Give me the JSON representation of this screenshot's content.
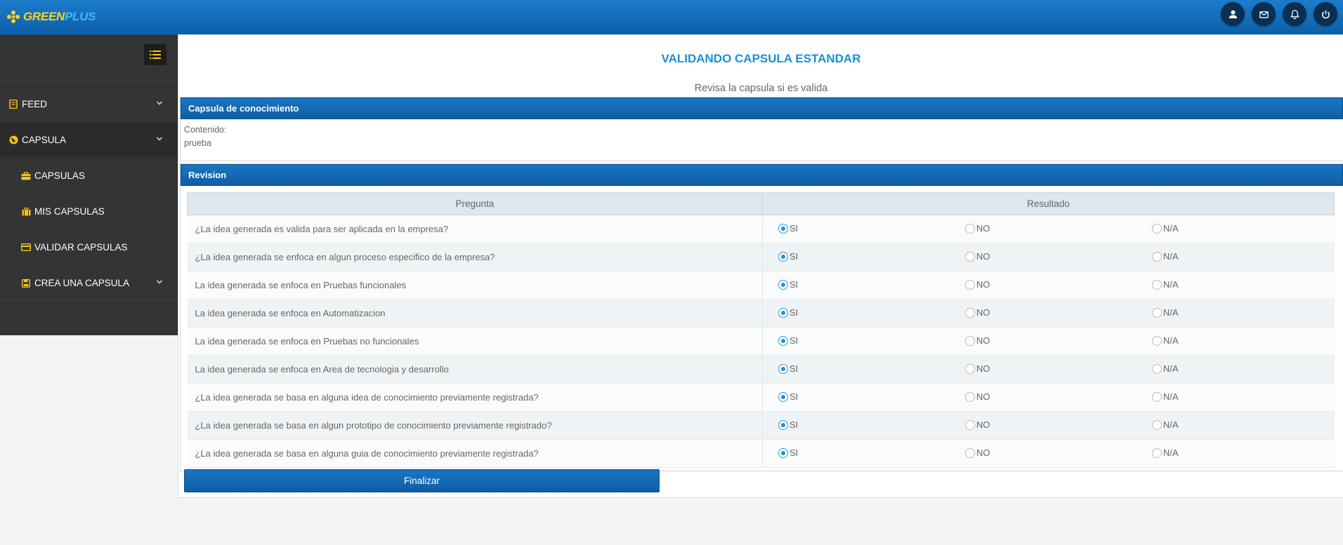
{
  "app": {
    "logo_green": "GREEN",
    "logo_plus": "PLUS",
    "top_icons": [
      "user-icon",
      "envelope-icon",
      "bell-icon",
      "power-icon"
    ]
  },
  "sidebar": {
    "items": [
      {
        "label": "FEED",
        "icon": "book-icon",
        "submenu": true
      },
      {
        "label": "CAPSULA",
        "icon": "globe-icon",
        "submenu": true
      },
      {
        "label": "CAPSULAS",
        "icon": "briefcase-icon",
        "submenu": false
      },
      {
        "label": "MIS CAPSULAS",
        "icon": "suitcase-icon",
        "submenu": false
      },
      {
        "label": "VALIDAR CAPSULAS",
        "icon": "card-icon",
        "submenu": false
      },
      {
        "label": "CREA UNA CAPSULA",
        "icon": "save-icon",
        "submenu": true
      }
    ]
  },
  "page": {
    "title": "VALIDANDO CAPSULA ESTANDAR",
    "subtitle": "Revisa la capsula si es valida"
  },
  "capsula_panel": {
    "heading": "Capsula de conocimiento",
    "content_label": "Contenido:",
    "content_value": "prueba"
  },
  "revision_panel": {
    "heading": "Revision",
    "columns": [
      "Pregunta",
      "Resultado"
    ],
    "option_labels": [
      "SI",
      "NO",
      "N/A"
    ],
    "rows": [
      {
        "question": "¿La idea generada es valida para ser aplicada en la empresa?",
        "selected": "SI"
      },
      {
        "question": "¿La idea generada se enfoca en algun proceso especifico de la empresa?",
        "selected": "SI"
      },
      {
        "question": "La idea generada se enfoca en Pruebas funcionales",
        "selected": "SI"
      },
      {
        "question": "La idea generada se enfoca en Automatizacion",
        "selected": "SI"
      },
      {
        "question": "La idea generada se enfoca en Pruebas no funcionales",
        "selected": "SI"
      },
      {
        "question": "La idea generada se enfoca en Area de tecnologia y desarrollo",
        "selected": "SI"
      },
      {
        "question": "¿La idea generada se basa en alguna idea de conocimiento previamente registrada?",
        "selected": "SI"
      },
      {
        "question": "¿La idea generada se basa en algun prototipo de conocimiento previamente registrado?",
        "selected": "SI"
      },
      {
        "question": "¿La idea generada se basa en alguna guia de conocimiento previamente registrada?",
        "selected": "SI"
      }
    ],
    "finish_label": "Finalizar"
  },
  "colors": {
    "topbar": "#1c7ccb",
    "accent": "#1b8fd6",
    "logo_yellow": "#ffd21f",
    "sidebar_bg": "#343434",
    "sidebar_icon": "#f5c518"
  }
}
